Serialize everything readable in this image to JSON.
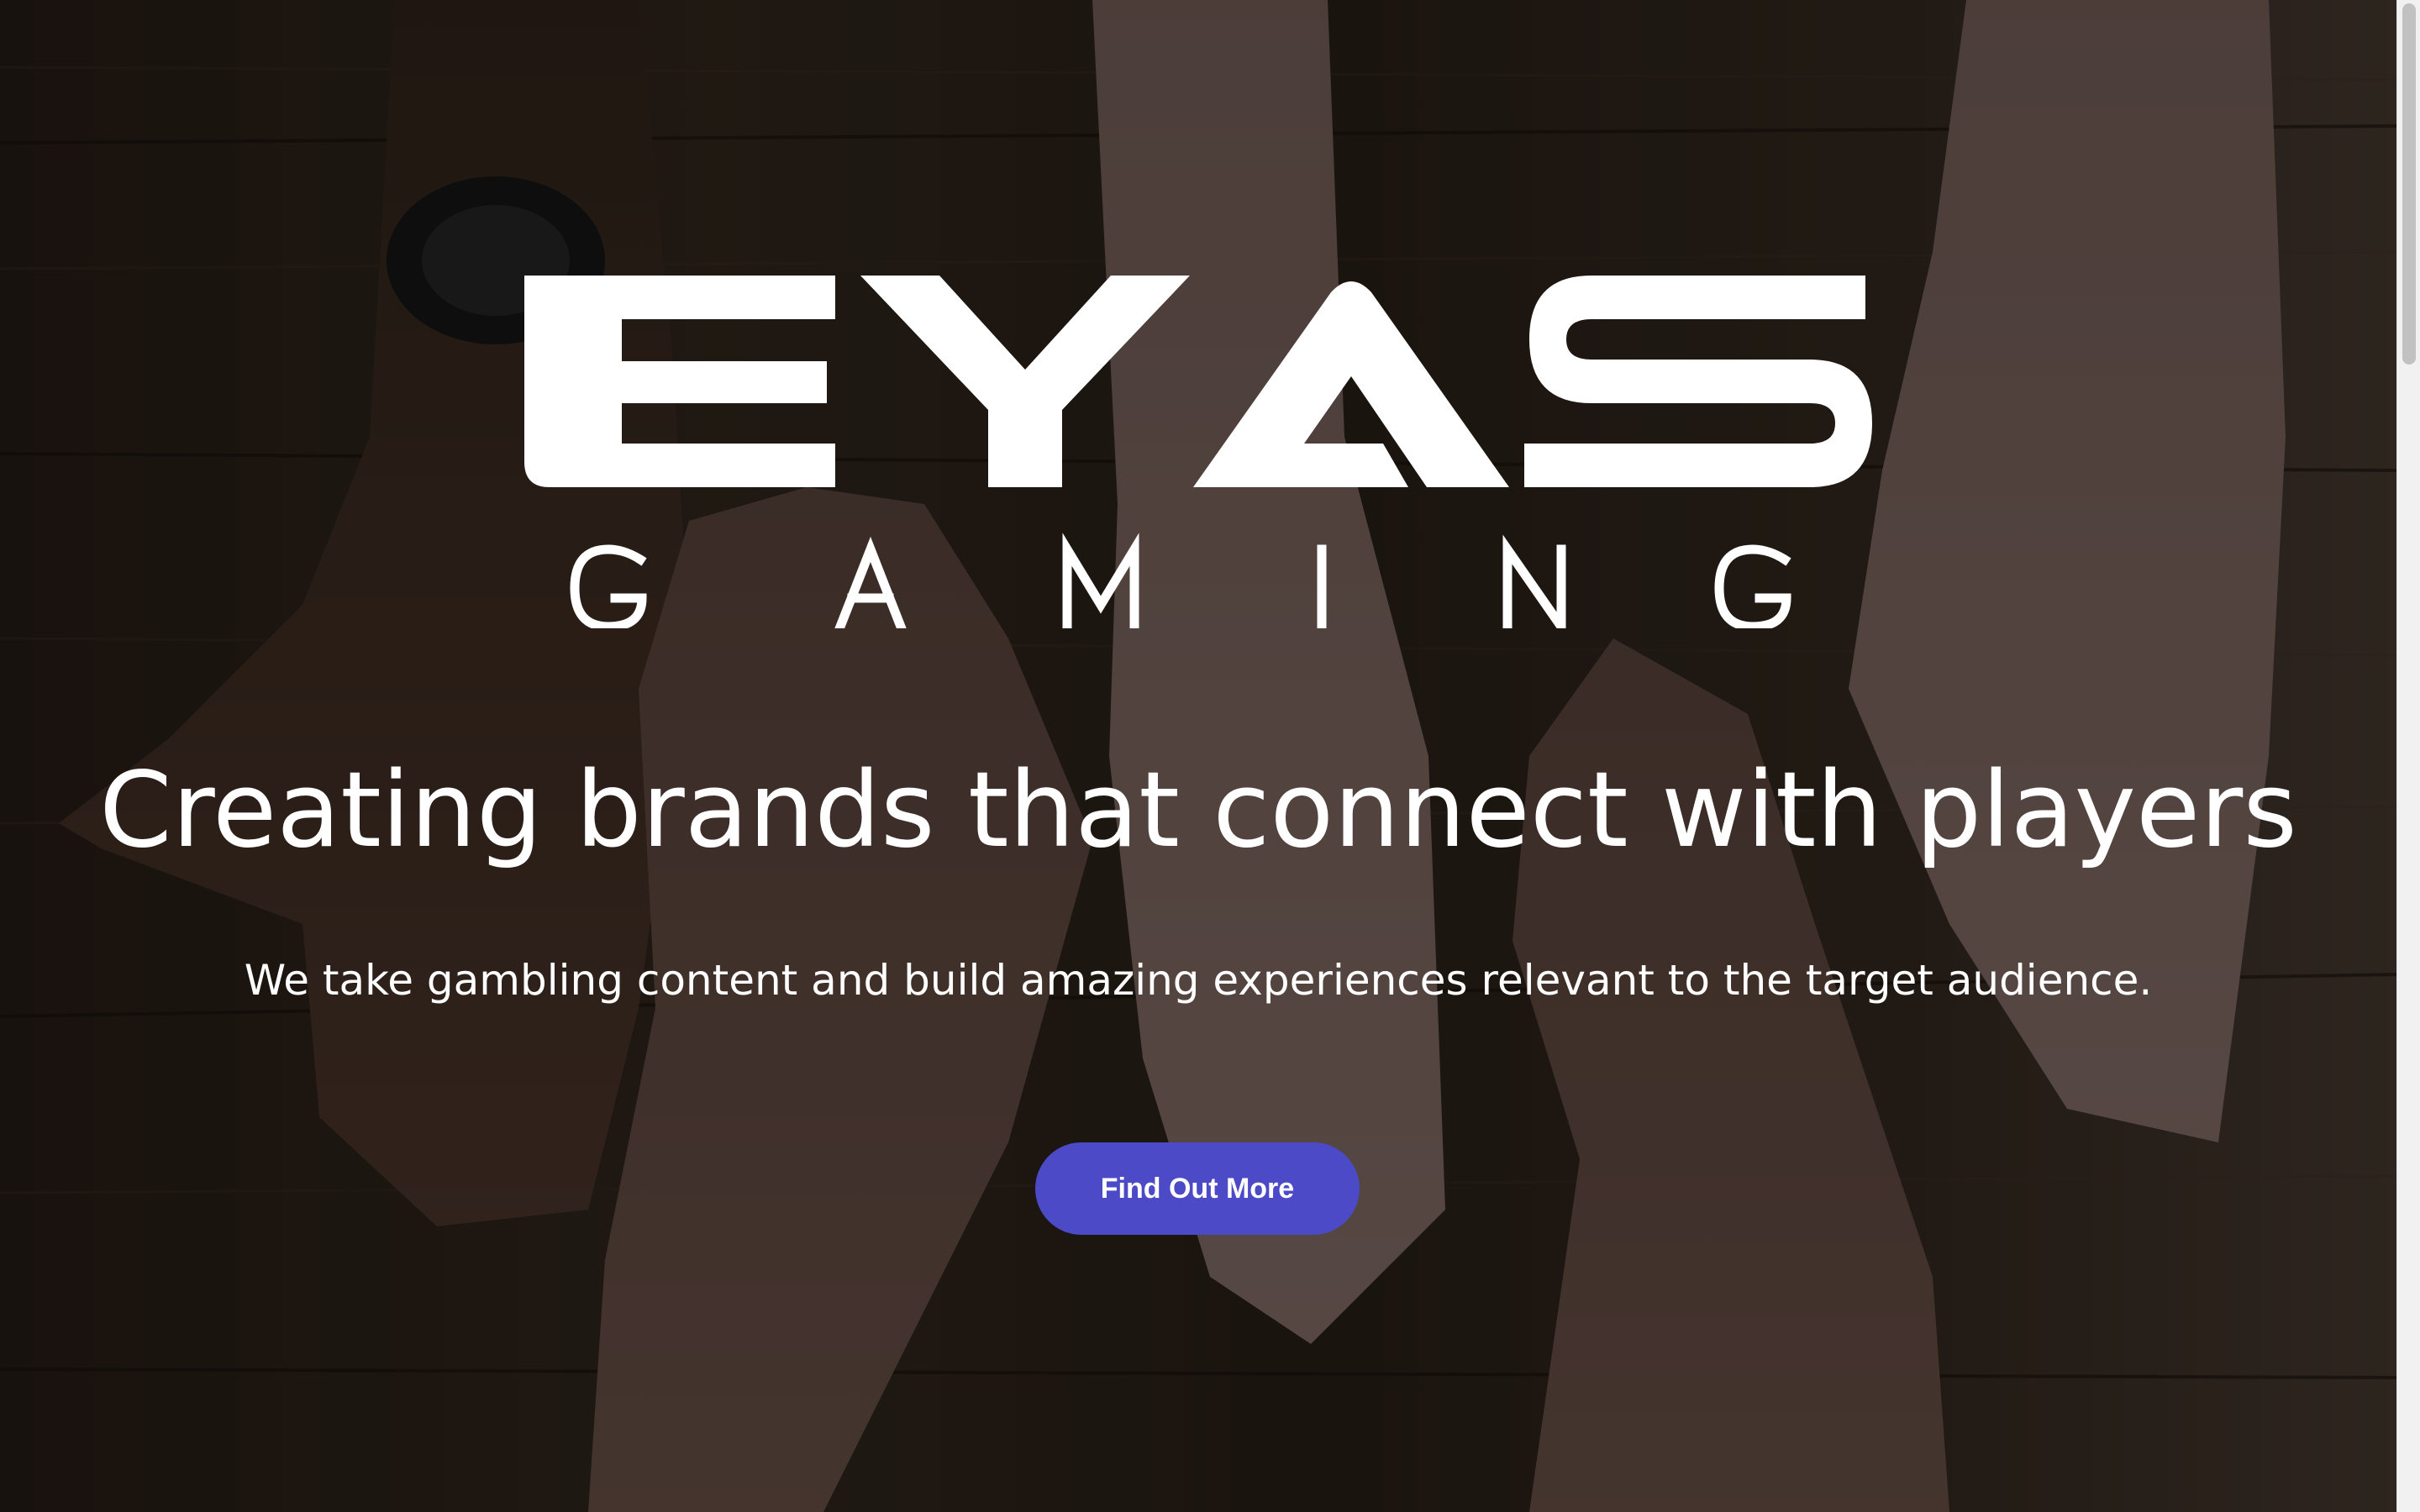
{
  "hero": {
    "logo_word": "EYAS",
    "logo_tagline": "GAMING",
    "headline": "Creating brands that connect with players",
    "subline": "We take gambling content and build amazing experiences relevant to the target audience.",
    "cta_label": "Find Out More"
  },
  "colors": {
    "accent": "#4c4ac6",
    "text": "#ffffff"
  }
}
